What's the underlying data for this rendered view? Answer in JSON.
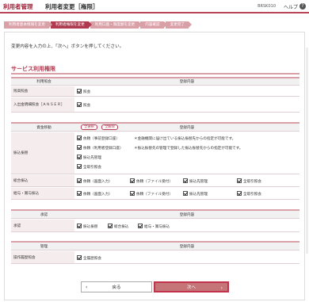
{
  "header": {
    "system_name": "利用者管理",
    "page_title": "利用者変更［権限］",
    "screen_id": "BRSK010",
    "help_label": "ヘルプ",
    "help_icon_glyph": "?"
  },
  "steps": [
    {
      "label": "利用者基本情報を変更",
      "active": false
    },
    {
      "label": "利用者権限を変更",
      "active": true
    },
    {
      "label": "利用口座・限度額を変更",
      "active": false
    },
    {
      "label": "内容確認",
      "active": false
    },
    {
      "label": "変更完了",
      "active": false
    }
  ],
  "message": "変更内容を入力の上、「次へ」ボタンを押してください。",
  "section_title": "サービス利用権限",
  "table_header": {
    "category": "利用照会",
    "content": "登録内容"
  },
  "inquiry": {
    "rows": [
      {
        "label": "残高照会",
        "option": "照会"
      },
      {
        "label": "入出金明細照会［ＡＮＳＥＲ］",
        "option": "照会"
      }
    ]
  },
  "transfer": {
    "header_label": "資金移動",
    "select_all": "全選択",
    "clear_all": "全解除",
    "content_header": "登録内容",
    "transfer_label": "振込振替",
    "transfer_options": [
      {
        "option": "依頼（事前登録口座）",
        "note": "＊金融機関に届け出ている振込振替先からの指定が可能です。"
      },
      {
        "option": "依頼（利用者登録口座）",
        "note": "＊振込振替先の管理で登録した振込振替先からの指定が可能です。"
      },
      {
        "option": "振込先管理",
        "note": ""
      },
      {
        "option": "全取引照会",
        "note": ""
      }
    ],
    "total_label": "総合振込",
    "total_options": [
      "依頼（画面入力）",
      "依頼（ファイル受付）",
      "振込先管理",
      "全取引照会"
    ],
    "salary_label": "給与・賞与振込",
    "salary_options": [
      "依頼（画面入力）",
      "依頼（ファイル受付）",
      "振込先管理",
      "全取引照会"
    ]
  },
  "approval": {
    "header_label": "承認",
    "content_header": "登録内容",
    "label": "承認",
    "options": [
      "振込振替",
      "総合振込",
      "給与・賞与振込"
    ]
  },
  "management": {
    "header_label": "管理",
    "content_header": "登録内容",
    "label": "操作履歴照会",
    "option": "全履歴照会"
  },
  "buttons": {
    "back_label": "戻る",
    "next_label": "次へ"
  },
  "colors": {
    "brand": "#b03a50",
    "brand_light": "#d9a0a8",
    "next_button": "#c57478"
  }
}
